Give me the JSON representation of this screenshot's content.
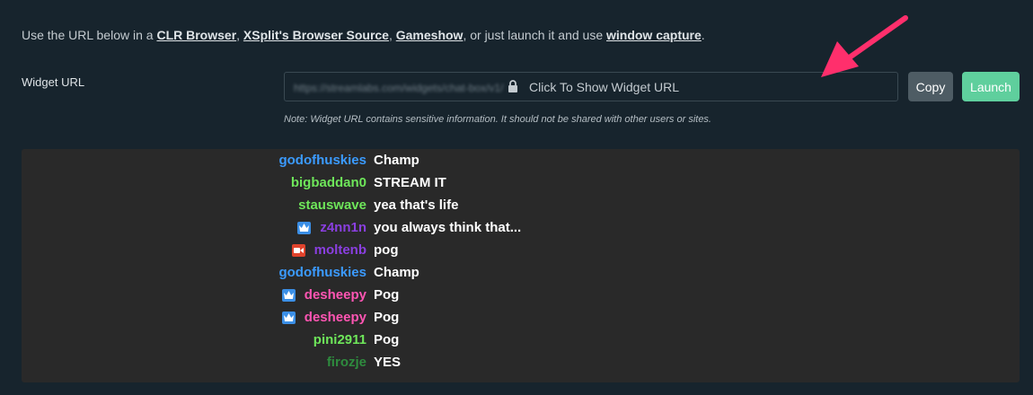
{
  "intro": {
    "prefix": "Use the URL below in a ",
    "link_clr": "CLR Browser",
    "sep1": ", ",
    "link_xsplit": "XSplit's Browser Source",
    "sep2": ", ",
    "link_gameshow": "Gameshow",
    "middle": ", or just launch it and use ",
    "link_window": "window capture",
    "suffix": "."
  },
  "widget_url": {
    "label": "Widget URL",
    "blurred_url": "https://streamlabs.com/widgets/chat-box/v1/",
    "show_label": "Click To Show Widget URL",
    "copy_label": "Copy",
    "launch_label": "Launch",
    "note": "Note: Widget URL contains sensitive information. It should not be shared with other users or sites."
  },
  "colors": {
    "arrow": "#ff2f6c",
    "launch": "#5fcf9d",
    "copy": "#4e5c64"
  },
  "chat": {
    "messages": [
      {
        "user": "godofhuskies",
        "color": "#3b9bff",
        "badge": "",
        "text": "Champ"
      },
      {
        "user": "bigbaddan0",
        "color": "#6ee65a",
        "badge": "",
        "text": "STREAM IT"
      },
      {
        "user": "stauswave",
        "color": "#6ee65a",
        "badge": "",
        "text": "yea that's life"
      },
      {
        "user": "z4nn1n",
        "color": "#8a3fe0",
        "badge": "crown-icon",
        "text": "you always think that..."
      },
      {
        "user": "moltenb",
        "color": "#8a3fe0",
        "badge": "video-icon",
        "text": "pog"
      },
      {
        "user": "godofhuskies",
        "color": "#3b9bff",
        "badge": "",
        "text": "Champ"
      },
      {
        "user": "desheepy",
        "color": "#ff55b3",
        "badge": "crown-icon",
        "text": "Pog"
      },
      {
        "user": "desheepy",
        "color": "#ff55b3",
        "badge": "crown-icon",
        "text": "Pog"
      },
      {
        "user": "pini2911",
        "color": "#6ee65a",
        "badge": "",
        "text": "Pog"
      },
      {
        "user": "firozje",
        "color": "#2e8b3e",
        "badge": "",
        "text": "YES"
      }
    ]
  }
}
